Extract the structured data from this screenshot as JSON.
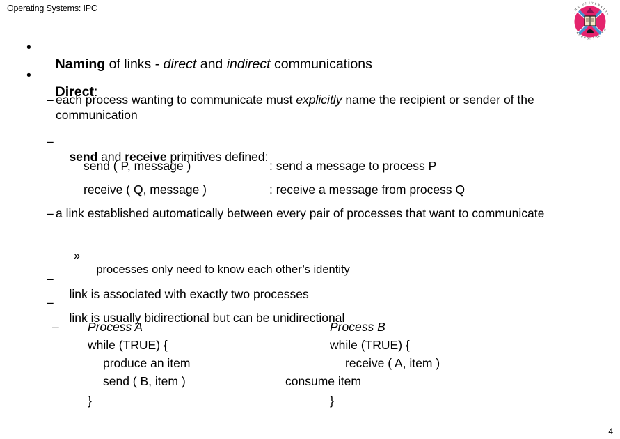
{
  "slide": {
    "header_title": "Operating Systems: IPC",
    "page_number": "4",
    "logo_name": "university-of-edinburgh-crest"
  },
  "bullets": {
    "naming": {
      "marker": "•",
      "part_bold": "Naming",
      "part_plain_1": " of links - ",
      "part_italic_1": "direct",
      "part_plain_2": " and ",
      "part_italic_2": "indirect",
      "part_plain_3": " communications"
    },
    "direct": {
      "marker": "•",
      "part_bold": "Direct",
      "part_plain": ":"
    }
  },
  "sub_bullets": {
    "each_process": {
      "marker": "–",
      "text_1": "each process wanting to communicate must ",
      "italic": "explicitly",
      "text_2": " name the recipient or sender of the communication"
    },
    "primitives": {
      "marker": "–",
      "bold_1": "send",
      "plain_1": " and ",
      "bold_2": "receive",
      "plain_2": " primitives defined:"
    },
    "auto_link": {
      "marker": "–",
      "text": "a link established automatically between every pair of processes that want to communicate"
    },
    "identity": {
      "marker": "»",
      "text": "processes only need to know each other’s identity"
    },
    "two_processes": {
      "marker": "–",
      "text": "link is associated with exactly two processes"
    },
    "bidirectional": {
      "marker": "–",
      "text": "link is usually bidirectional but can be unidirectional"
    },
    "code_dash": {
      "marker": "–"
    }
  },
  "primitives_table": {
    "rows": [
      {
        "call": "send ( P, message )",
        "desc": ": send a message to process P"
      },
      {
        "call": "receive ( Q, message )",
        "desc": ": receive a message from process Q"
      }
    ]
  },
  "code_example": {
    "process_a": {
      "title": "Process A",
      "line_1": "while (TRUE) {",
      "line_2": "produce an item",
      "line_3": "send ( B, item )",
      "line_4": "}"
    },
    "process_b": {
      "title": "Process B",
      "line_1": "while (TRUE) {",
      "line_2": "receive ( A, item )",
      "line_3": "consume item",
      "line_4": "}"
    }
  },
  "colors": {
    "crest_pink": "#e4246d",
    "crest_blue": "#4a8fd0",
    "text": "#000000",
    "background": "#ffffff"
  }
}
